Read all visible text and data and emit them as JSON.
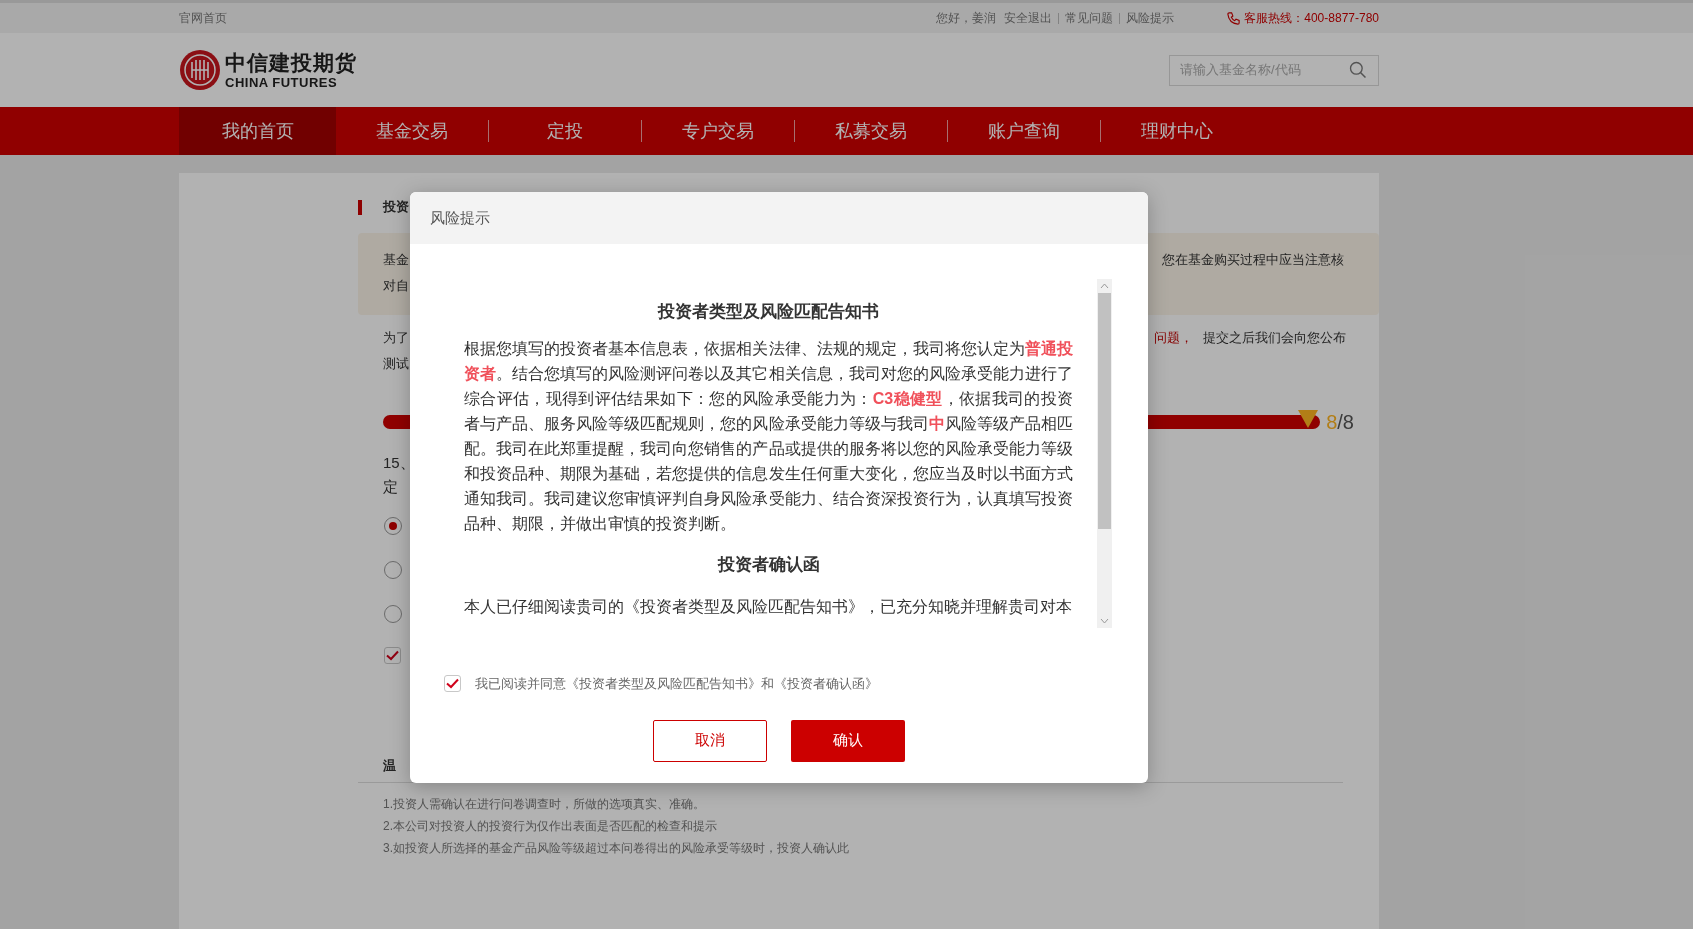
{
  "top_bar": {
    "home_link": "官网首页",
    "greeting": "您好，姜润",
    "links": [
      "安全退出",
      "常见问题",
      "风险提示"
    ],
    "hotline": "客服热线：400-8877-780"
  },
  "header": {
    "logo_cn": "中信建投期货",
    "logo_en": "CHINA FUTURES",
    "search": {
      "placeholder": "请输入基金名称/代码"
    }
  },
  "nav": [
    {
      "label": "我的首页",
      "selected": true
    },
    {
      "label": "基金交易",
      "selected": false
    },
    {
      "label": "定投",
      "selected": false
    },
    {
      "label": "专户交易",
      "selected": false
    },
    {
      "label": "私募交易",
      "selected": false
    },
    {
      "label": "账户查询",
      "selected": false
    },
    {
      "label": "理财中心",
      "selected": false
    }
  ],
  "page": {
    "section_title": "投资",
    "notice": {
      "line_1_left": "基金",
      "line_1_right": "您在基金购买过程中应当注意核",
      "line_2_left": "对自"
    },
    "intro": {
      "line_1_left": "为了",
      "line_1_right_red": "问题，",
      "line_1_right": "提交之后我们会向您公布",
      "line_2_left": "测试"
    },
    "progress": {
      "level": 1,
      "current": "8",
      "total": "/8"
    },
    "question": [
      "15、",
      "定"
    ],
    "options": [
      {
        "selected": true
      },
      {
        "selected": false
      },
      {
        "selected": false
      }
    ],
    "confirm_checkbox": {
      "checked": true
    },
    "tips_title": "温",
    "tips": [
      "1.投资人需确认在进行问卷调查时，所做的选项真实、准确。",
      "2.本公司对投资人的投资行为仅作出表面是否匹配的检查和提示",
      "3.如投资人所选择的基金产品风险等级超过本问卷得出的风险承受等级时，投资人确认此"
    ]
  },
  "dialog": {
    "title": "风险提示",
    "doc_title": "投资者类型及风险匹配告知书",
    "doc_text": "根据您填写的投资者基本信息表，依据相关法律、法规的规定，我司将您认定为**普通投资者**。结合您填写的风险测评问卷以及其它相关信息，我司对您的风险承受能力进行了综合评估，现得到评估结果如下：您的风险承受能力为：**C3稳健型**，依据我司的投资者与产品、服务风险等级匹配规则，您的风险承受能力等级与我司**中**风险等级产品相匹配。我司在此郑重提醒，我司向您销售的产品或提供的服务将以您的风险承受能力等级和投资品种、期限为基础，若您提供的信息发生任何重大变化，您应当及时以书面方式通知我司。我司建议您审慎评判自身风险承受能力、结合资深投资行为，认真填写投资品种、期限，并做出审慎的投资判断。",
    "letter_title": "投资者确认函",
    "letter_text": "本人已仔细阅读贵司的《投资者类型及风险匹配告知书》，已充分知晓并理解贵司对本",
    "agree": {
      "checked": true,
      "label": "我已阅读并同意《投资者类型及风险匹配告知书》和《投资者确认函》"
    },
    "buttons": [
      {
        "label": "取消",
        "kind": "secondary"
      },
      {
        "label": "确认",
        "kind": "primary"
      }
    ]
  }
}
